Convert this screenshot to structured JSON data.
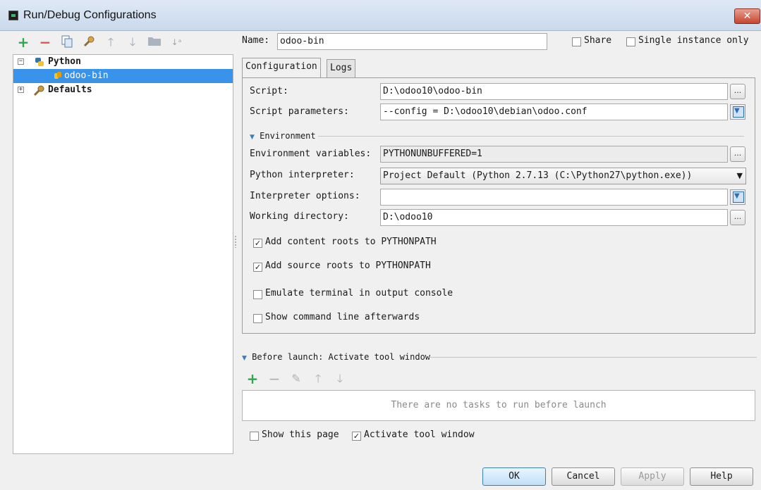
{
  "window": {
    "title": "Run/Debug Configurations",
    "close_glyph": "✕"
  },
  "toolbar": {
    "icons": [
      "add-icon",
      "remove-icon",
      "copy-icon",
      "edit-defaults-icon",
      "move-up-icon",
      "move-down-icon",
      "folder-icon",
      "sort-icon"
    ]
  },
  "tree": {
    "items": [
      {
        "label": "Python",
        "icon": "python-icon",
        "expander": "−"
      },
      {
        "label": "odoo-bin",
        "icon": "python-file-icon"
      },
      {
        "label": "Defaults",
        "icon": "wrench-icon",
        "expander": "+"
      }
    ]
  },
  "config": {
    "name_label": "Name:",
    "name_value": "odoo-bin",
    "share_label": "Share",
    "share_checked": false,
    "single_instance_label": "Single instance only",
    "single_instance_checked": false
  },
  "tabs": [
    {
      "label": "Configuration",
      "active": true
    },
    {
      "label": "Logs",
      "active": false
    }
  ],
  "form": {
    "script_label": "Script:",
    "script_value": "D:\\odoo10\\odoo-bin",
    "params_label": "Script parameters:",
    "params_value": "--config = D:\\odoo10\\debian\\odoo.conf",
    "environment_title": "Environment",
    "env_vars_label": "Environment variables:",
    "env_vars_value": "PYTHONUNBUFFERED=1",
    "interpreter_label": "Python interpreter:",
    "interpreter_value": "Project Default (Python 2.7.13 (C:\\Python27\\python.exe))",
    "interp_options_label": "Interpreter options:",
    "interp_options_value": "",
    "workdir_label": "Working directory:",
    "workdir_value": "D:\\odoo10",
    "browse_glyph": "...",
    "checks": [
      {
        "label": "Add content roots to PYTHONPATH",
        "checked": true
      },
      {
        "label": "Add source roots to PYTHONPATH",
        "checked": true
      },
      {
        "label": "Emulate terminal in output console",
        "checked": false
      },
      {
        "label": "Show command line afterwards",
        "checked": false
      }
    ]
  },
  "before_launch": {
    "title": "Before launch: Activate tool window",
    "icons": [
      "add-task-icon",
      "remove-task-icon",
      "edit-task-icon",
      "task-up-icon",
      "task-down-icon"
    ],
    "empty_text": "There are no tasks to run before launch",
    "show_page_label": "Show this page",
    "show_page_checked": false,
    "activate_label": "Activate tool window",
    "activate_checked": true
  },
  "buttons": {
    "ok": "OK",
    "cancel": "Cancel",
    "apply": "Apply",
    "help": "Help"
  },
  "colors": {
    "selection": "#3a93eb",
    "add_green": "#2ea84a",
    "remove_red": "#d9534f"
  }
}
